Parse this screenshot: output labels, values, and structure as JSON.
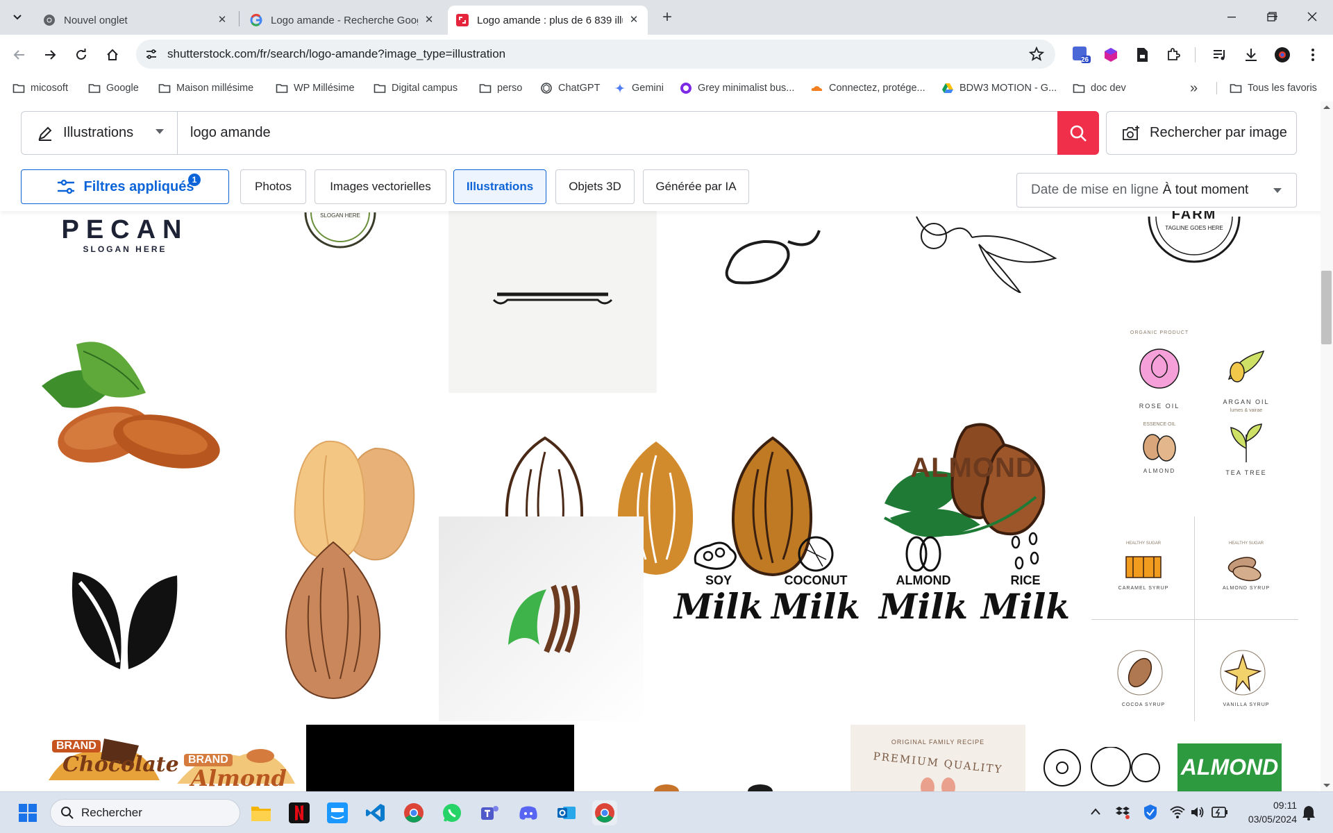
{
  "browser": {
    "tabs": [
      {
        "title": "Nouvel onglet",
        "icon": "chrome-icon"
      },
      {
        "title": "Logo amande - Recherche Goog",
        "icon": "google-icon"
      },
      {
        "title": "Logo amande : plus de 6 839 illu",
        "icon": "shutterstock-icon",
        "active": true
      }
    ],
    "url": "shutterstock.com/fr/search/logo-amande?image_type=illustration",
    "extension_badge": "26",
    "bookmarks": [
      {
        "label": "micosoft",
        "icon": "folder-icon"
      },
      {
        "label": "Google",
        "icon": "folder-icon"
      },
      {
        "label": "Maison millésime",
        "icon": "folder-icon"
      },
      {
        "label": "WP Millésime",
        "icon": "folder-icon"
      },
      {
        "label": "Digital campus",
        "icon": "folder-icon"
      },
      {
        "label": "perso",
        "icon": "folder-icon"
      },
      {
        "label": "ChatGPT",
        "icon": "chatgpt-icon"
      },
      {
        "label": "Gemini",
        "icon": "gemini-icon"
      },
      {
        "label": "Grey minimalist bus...",
        "icon": "canva-icon"
      },
      {
        "label": "Connectez, protége...",
        "icon": "cloudflare-icon"
      },
      {
        "label": "BDW3 MOTION - G...",
        "icon": "drive-icon"
      },
      {
        "label": "doc dev",
        "icon": "folder-icon"
      }
    ],
    "bookmarks_overflow": "»",
    "all_bookmarks": "Tous les favoris"
  },
  "search": {
    "type_label": "Illustrations",
    "query": "logo amande",
    "image_search_label": "Rechercher par image"
  },
  "filters": {
    "applied_label": "Filtres appliqués",
    "applied_count": "1",
    "chips": [
      "Photos",
      "Images vectorielles",
      "Illustrations",
      "Objets 3D",
      "Générée par IA"
    ],
    "selected_chip": "Illustrations",
    "date_label": "Date de mise en ligne",
    "date_value": "À tout moment"
  },
  "results": {
    "pecan_title": "PECAN",
    "pecan_sub": "SLOGAN HERE",
    "slogan_here": "SLOGAN HERE",
    "farm": "FARM",
    "farm_tagline": "TAGLINE GOES HERE",
    "almond_logo": "ALMOND",
    "oils": {
      "top": "ORGANIC PRODUCT",
      "rose": "ROSE OIL",
      "argan": "ARGAN OIL",
      "argan_sub": "lumes & vairae",
      "essence": "ESSENCE OIL",
      "almond": "ALMOND",
      "tea": "TEA TREE"
    },
    "milk": [
      {
        "name": "SOY",
        "word": "Milk"
      },
      {
        "name": "COCONUT",
        "word": "Milk"
      },
      {
        "name": "ALMOND",
        "word": "Milk"
      },
      {
        "name": "RICE",
        "word": "Milk"
      }
    ],
    "syrups": {
      "healthy": "HEALTHY SUGAR",
      "caramel": "CARAMEL SYRUP",
      "almond": "ALMOND SYRUP",
      "cocoa": "COCOA SYRUP",
      "vanilla": "VANILLA SYRUP"
    },
    "brand": "BRAND",
    "chocolate": "Chocolate",
    "almond_script": "Almond",
    "family_recipe": "ORIGINAL FAMILY RECIPE",
    "premium": "PREMIUM QUALITY",
    "almond_green": "ALMOND"
  },
  "taskbar": {
    "search_label": "Rechercher",
    "time": "09:11",
    "date": "03/05/2024",
    "apps": [
      "start-icon",
      "file-explorer-icon",
      "netflix-icon",
      "prime-video-icon",
      "vscode-icon",
      "chrome-icon",
      "whatsapp-icon",
      "teams-icon",
      "discord-icon",
      "outlook-icon",
      "chrome-icon"
    ]
  },
  "colors": {
    "accent": "#0c64d8",
    "search_red": "#f0304a",
    "almond_brown": "#6b3a1f",
    "almond_orange": "#c9772e",
    "leaf_green": "#2e8b3a"
  }
}
